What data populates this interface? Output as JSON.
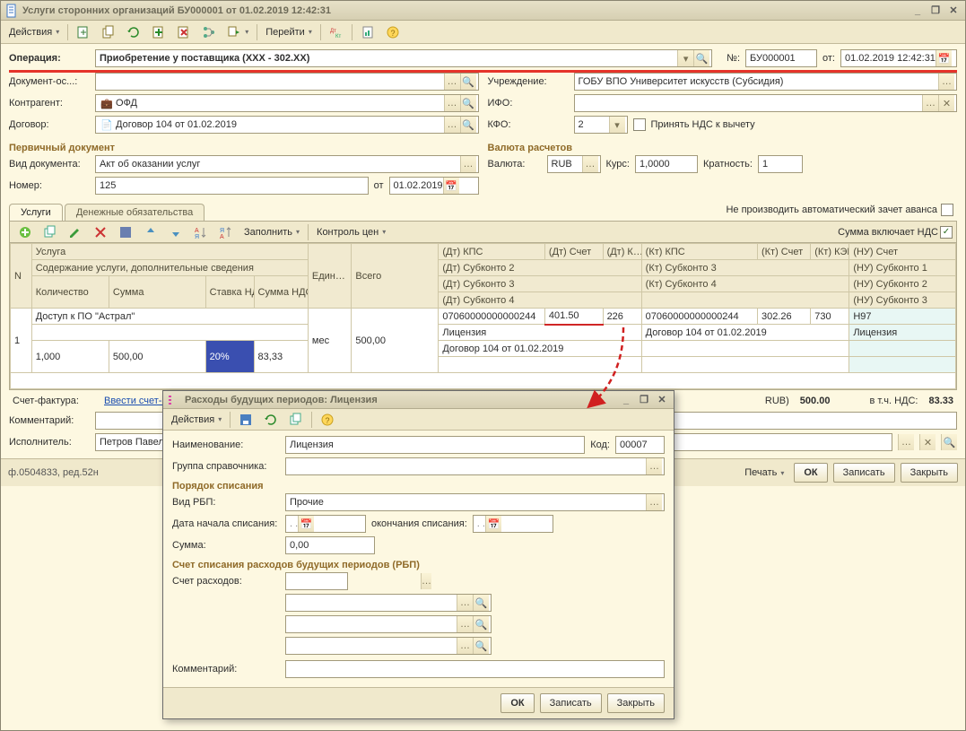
{
  "window": {
    "title": "Услуги сторонних организаций БУ000001 от 01.02.2019 12:42:31"
  },
  "toolbar": {
    "actions": "Действия",
    "goto": "Перейти"
  },
  "header": {
    "operation_lbl": "Операция:",
    "operation_val": "Приобретение у поставщика (XXX - 302.XX)",
    "no_lbl": "№:",
    "no_val": "БУ000001",
    "from_lbl": "от:",
    "from_val": "01.02.2019 12:42:31",
    "doc_basis_lbl": "Документ-ос...:",
    "doc_basis_val": "",
    "contragent_lbl": "Контрагент:",
    "contragent_val": "ОФД",
    "contract_lbl": "Договор:",
    "contract_val": "Договор 104 от 01.02.2019",
    "org_lbl": "Учреждение:",
    "org_val": "ГОБУ ВПО Университет искусств (Субсидия)",
    "ifo_lbl": "ИФО:",
    "ifo_val": "",
    "kfo_lbl": "КФО:",
    "kfo_val": "2",
    "vat_accept": "Принять НДС к вычету",
    "primary_doc_title": "Первичный документ",
    "currency_title": "Валюта расчетов",
    "doc_type_lbl": "Вид документа:",
    "doc_type_val": "Акт об оказании услуг",
    "number_lbl": "Номер:",
    "number_val": "125",
    "number_from_lbl": "от",
    "number_from_val": "01.02.2019",
    "currency_lbl": "Валюта:",
    "currency_val": "RUB",
    "rate_lbl": "Курс:",
    "rate_val": "1,0000",
    "mult_lbl": "Кратность:",
    "mult_val": "1"
  },
  "tabs": {
    "t1": "Услуги",
    "t2": "Денежные обязательства",
    "auto_offset_lbl": "Не производить автоматический зачет аванса"
  },
  "gridbar": {
    "fill": "Заполнить",
    "price_control": "Контроль цен",
    "sum_includes_vat": "Сумма включает НДС"
  },
  "grid": {
    "h_n": "N",
    "h_service": "Услуга",
    "h_unit": "Един…",
    "h_total": "Всего",
    "h_dt_kps": "(Дт) КПС",
    "h_dt_acct": "(Дт) Счет",
    "h_dt_k": "(Дт) К…",
    "h_kt_kps": "(Кт) КПС",
    "h_kt_acct": "(Кт) Счет",
    "h_kt_kek": "(Кт) КЭК",
    "h_nu_acct": "(НУ) Счет",
    "h_details": "Содержание услуги, дополнительные сведения",
    "h_dt_sub2": "(Дт) Субконто 2",
    "h_kt_sub3": "(Кт) Субконто 3",
    "h_nu_sub1": "(НУ) Субконто 1",
    "h_qty": "Количество",
    "h_sum": "Сумма",
    "h_vat_rate": "Ставка НДС",
    "h_vat_sum": "Сумма НДС",
    "h_dt_sub3": "(Дт) Субконто 3",
    "h_kt_sub4": "(Кт) Субконто 4",
    "h_nu_sub2": "(НУ) Субконто 2",
    "h_dt_sub4": "(Дт) Субконто 4",
    "h_nu_sub3": "(НУ) Субконто 3",
    "r1_n": "1",
    "r1_service": "Доступ к ПО \"Астрал\"",
    "r1_unit": "мес",
    "r1_total": "500,00",
    "r1_dt_kps": "07060000000000244",
    "r1_dt_acct": "401.50",
    "r1_dt_k": "226",
    "r1_kt_kps": "07060000000000244",
    "r1_kt_acct": "302.26",
    "r1_kt_kek": "730",
    "r1_nu_acct": "Н97",
    "r1_sub2": "Лицензия",
    "r1_kt_sub3": "Договор 104 от 01.02.2019",
    "r1_nu_sub1": "Лицензия",
    "r1_qty": "1,000",
    "r1_sum": "500,00",
    "r1_vat_rate": "20%",
    "r1_vat_sum": "83,33",
    "r1_dt_sub3": "Договор 104 от 01.02.2019"
  },
  "footer": {
    "invoice_lbl": "Счет-фактура:",
    "invoice_link": "Ввести счет-факт",
    "rub_lbl": "RUB)",
    "total": "500.00",
    "vat_lbl": "в т.ч. НДС:",
    "vat_total": "83.33",
    "comment_lbl": "Комментарий:",
    "executor_lbl": "Исполнитель:",
    "executor_val": "Петров Павел Ив",
    "form_info": "ф.0504833, ред.52н",
    "print": "Печать",
    "ok": "ОК",
    "save": "Записать",
    "close": "Закрыть"
  },
  "dialog": {
    "title": "Расходы будущих периодов: Лицензия",
    "actions": "Действия",
    "name_lbl": "Наименование:",
    "name_val": "Лицензия",
    "code_lbl": "Код:",
    "code_val": "00007",
    "group_lbl": "Группа справочника:",
    "group_val": "",
    "section1": "Порядок списания",
    "type_lbl": "Вид РБП:",
    "type_val": "Прочие",
    "start_lbl": "Дата начала списания:",
    "start_val": "  .  .    ",
    "end_lbl": "окончания списания:",
    "end_val": "  .  .    ",
    "sum_lbl": "Сумма:",
    "sum_val": "0,00",
    "section2": "Счет списания расходов будущих периодов (РБП)",
    "acct_lbl": "Счет расходов:",
    "comment_lbl": "Комментарий:",
    "ok": "ОК",
    "save": "Записать",
    "close": "Закрыть"
  }
}
